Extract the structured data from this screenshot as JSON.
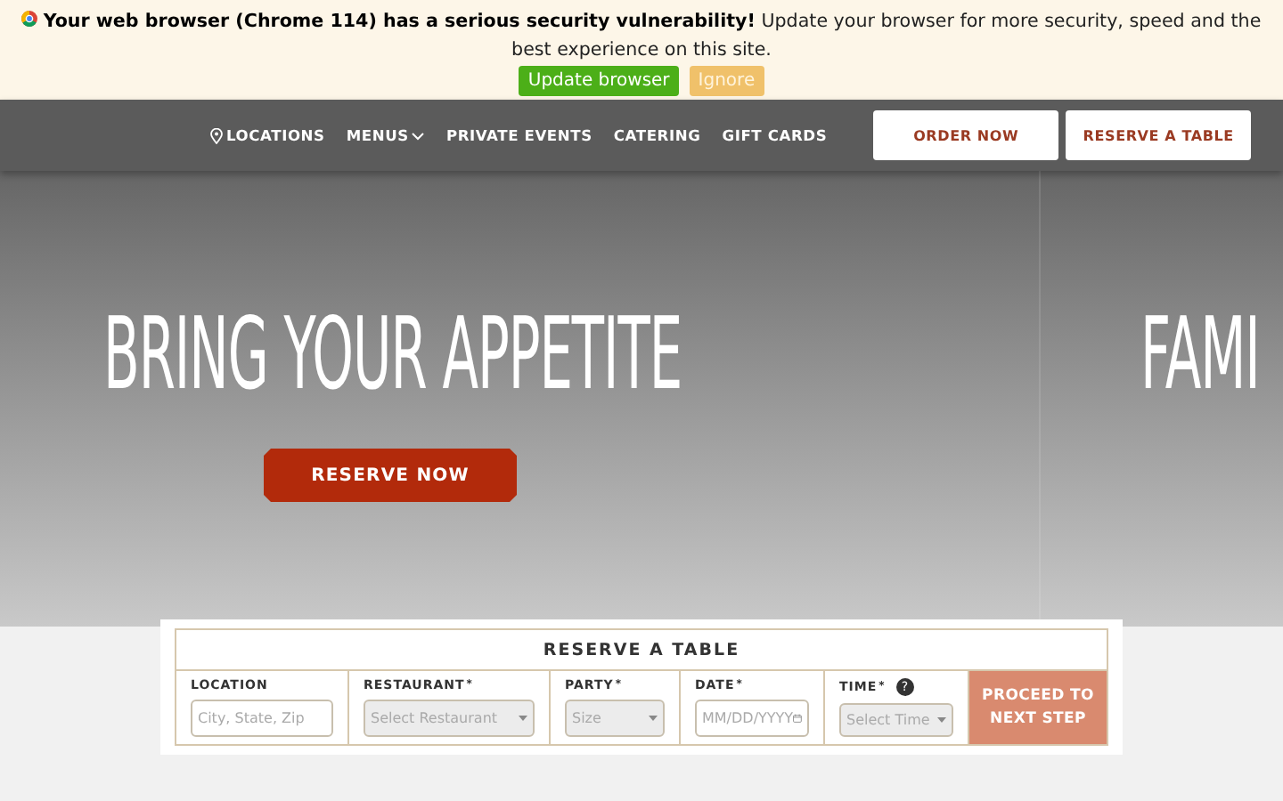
{
  "banner": {
    "headline": "Your web browser (Chrome 114) has a serious security vulnerability!",
    "message": "Update your browser for more security, speed and the best experience on this site.",
    "buttons": [
      {
        "label": "Update browser",
        "kind": "primary"
      },
      {
        "label": "Ignore",
        "kind": "secondary"
      }
    ]
  },
  "nav": {
    "links": [
      {
        "label": "LOCATIONS",
        "kind": "pin"
      },
      {
        "label": "MENUS",
        "kind": "dropdown"
      },
      {
        "label": "PRIVATE EVENTS",
        "kind": "plain"
      },
      {
        "label": "CATERING",
        "kind": "plain"
      },
      {
        "label": "GIFT CARDS",
        "kind": "plain"
      }
    ],
    "buttons": [
      "ORDER NOW",
      "RESERVE A TABLE"
    ]
  },
  "hero": {
    "slides": [
      {
        "headline": "BRING YOUR APPETITE",
        "button": "RESERVE NOW"
      },
      {
        "headline": "FAMI"
      }
    ]
  },
  "reservation": {
    "title": "RESERVE A TABLE",
    "fields": [
      {
        "label": "LOCATION",
        "kind": "text",
        "placeholder": "City, State, Zip",
        "disabled": false
      },
      {
        "label": "RESTAURANT",
        "required_mark": "*",
        "kind": "select",
        "placeholder": "Select Restaurant",
        "disabled": true
      },
      {
        "label": "PARTY",
        "required_mark": "*",
        "kind": "select",
        "placeholder": "Size",
        "disabled": true
      },
      {
        "label": "DATE",
        "required_mark": "*",
        "kind": "date",
        "placeholder": "MM/DD/YYYY",
        "disabled": false
      },
      {
        "label": "TIME",
        "required_mark": "*",
        "kind": "select",
        "placeholder": "Select Time",
        "disabled": true,
        "help": "?"
      }
    ],
    "submit": "PROCEED TO NEXT STEP"
  }
}
